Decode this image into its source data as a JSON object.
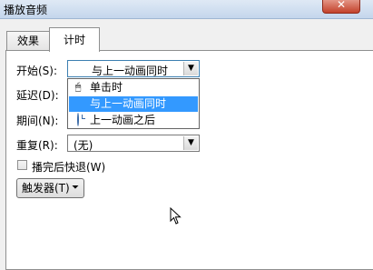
{
  "window": {
    "title": "播放音频",
    "close_label": "✕"
  },
  "tabs": [
    {
      "label": "效果",
      "active": false
    },
    {
      "label": "计时",
      "active": true
    }
  ],
  "form": {
    "start_label": "开始(S):",
    "start_value": "与上一动画同时",
    "delay_label": "延迟(D):",
    "duration_label": "期间(N):",
    "repeat_label": "重复(R):",
    "repeat_value": "(无)",
    "rewind_label": "播完后快退(W)",
    "rewind_checked": false,
    "trigger_label": "触发器(T)"
  },
  "start_options": [
    {
      "label": "单击时",
      "icon": "mouse-icon",
      "selected": false
    },
    {
      "label": "与上一动画同时",
      "icon": "",
      "selected": true
    },
    {
      "label": "上一动画之后",
      "icon": "clock-icon",
      "selected": false
    }
  ],
  "colors": {
    "selection": "#3399ff",
    "panel": "#ffffff",
    "background": "#f0f0f0"
  }
}
